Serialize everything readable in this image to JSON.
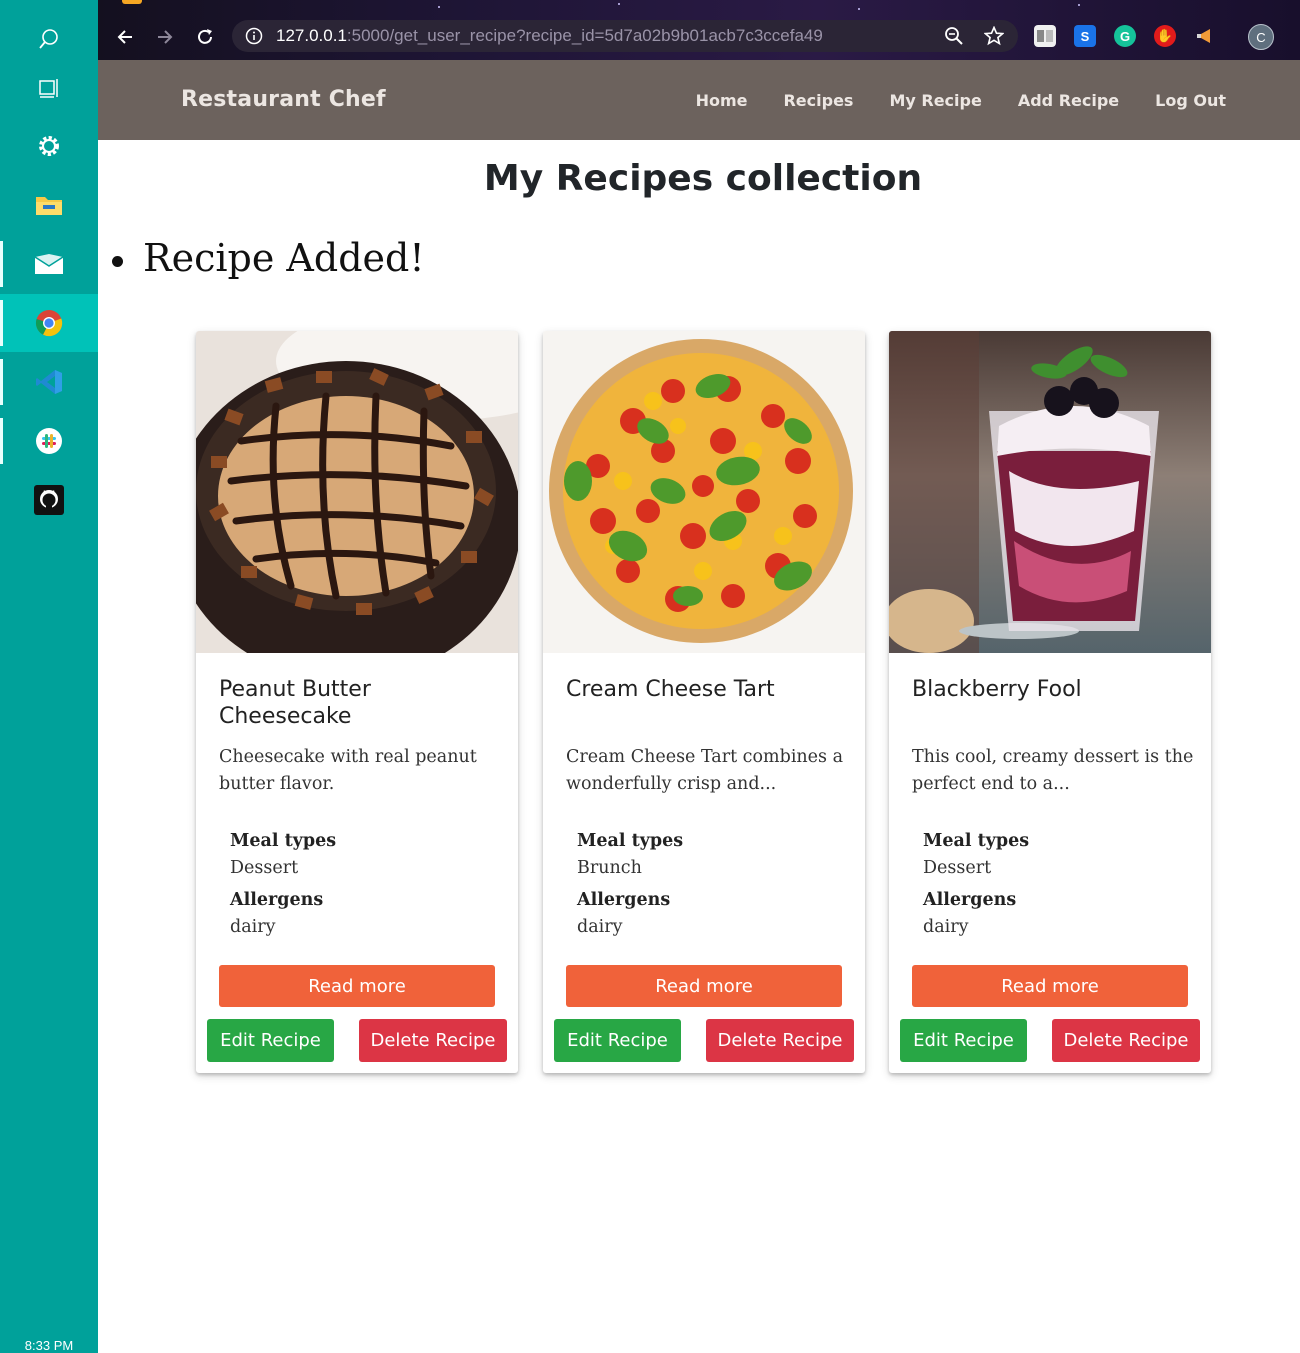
{
  "taskbar": {
    "icons": [
      "search-icon",
      "task-view-icon",
      "settings-gear-icon",
      "file-explorer-icon",
      "mail-icon",
      "chrome-icon",
      "vscode-icon",
      "slack-icon",
      "github-icon"
    ],
    "clock": "8:33 PM"
  },
  "browser": {
    "url_host": "127.0.0.1",
    "url_rest": ":5000/get_user_recipe?recipe_id=5d7a02b9b01acb7c3ccefa49",
    "profile_initial": "C"
  },
  "navbar": {
    "brand": "Restaurant Chef",
    "links": [
      "Home",
      "Recipes",
      "My Recipe",
      "Add Recipe",
      "Log Out"
    ]
  },
  "page": {
    "title": "My Recipes collection",
    "flash_message": "Recipe Added!"
  },
  "labels": {
    "meal_types": "Meal types",
    "allergens": "Allergens",
    "read_more": "Read more",
    "edit": "Edit Recipe",
    "delete": "Delete Recipe"
  },
  "recipes": [
    {
      "title": "Peanut Butter Cheesecake",
      "description": "Cheesecake with real peanut butter flavor.",
      "meal_type": "Dessert",
      "allergens": "dairy",
      "image": "cheesecake-photo"
    },
    {
      "title": "Cream Cheese Tart",
      "description": "Cream Cheese Tart combines a wonderfully crisp and...",
      "meal_type": "Brunch",
      "allergens": "dairy",
      "image": "tomato-tart-photo"
    },
    {
      "title": "Blackberry Fool",
      "description": "This cool, creamy dessert is the perfect end to a...",
      "meal_type": "Dessert",
      "allergens": "dairy",
      "image": "blackberry-fool-photo"
    }
  ],
  "colors": {
    "taskbar": "#00a19a",
    "navbar": "#6c625d",
    "read_more": "#f0623a",
    "edit": "#28a745",
    "delete": "#dc3545"
  }
}
